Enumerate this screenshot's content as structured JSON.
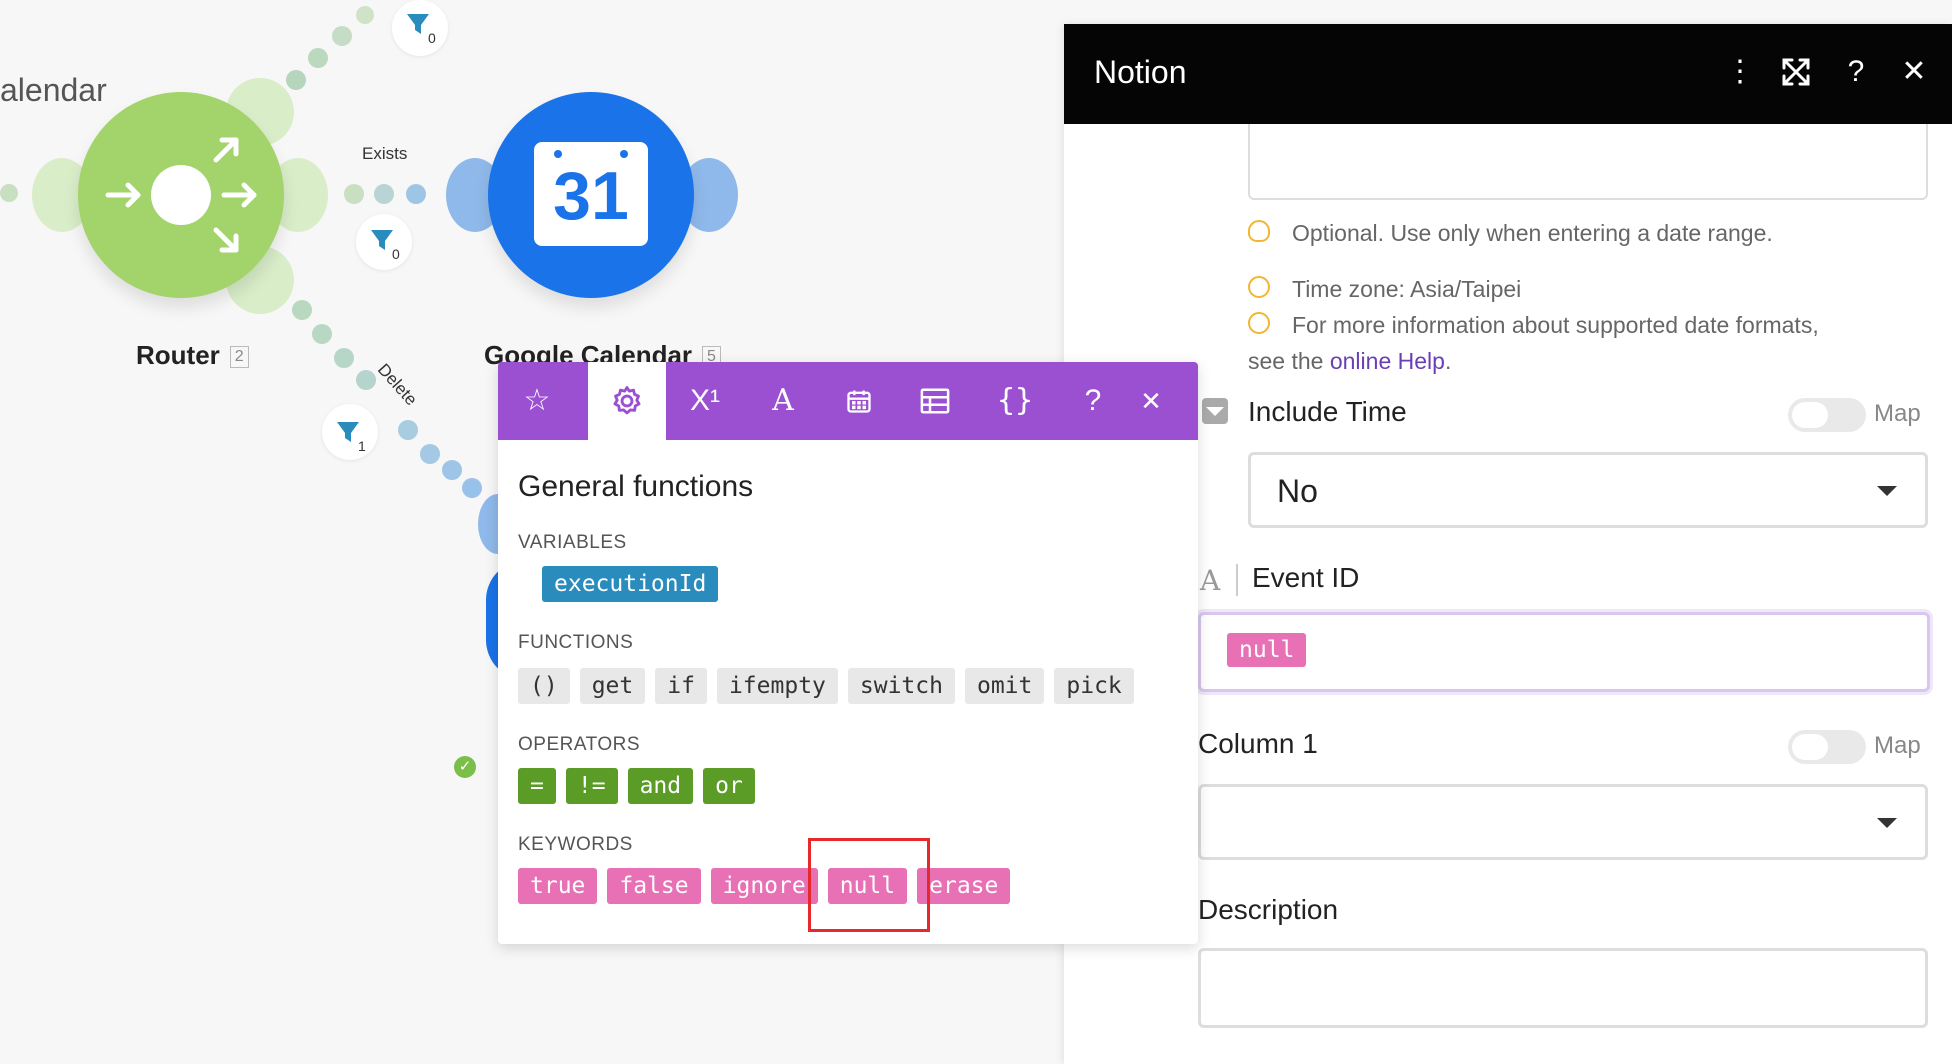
{
  "canvas": {
    "partial_title": "alendar",
    "router": {
      "label": "Router",
      "count": "2"
    },
    "gcal": {
      "label": "Google Calendar",
      "count": "5",
      "icon_text": "31"
    },
    "routes": {
      "exists_label": "Exists",
      "delete_label": "Delete"
    },
    "filters": [
      {
        "count": "0"
      },
      {
        "count": "0"
      },
      {
        "count": "1"
      }
    ]
  },
  "panel": {
    "title": "Notion",
    "hint_optional": "Optional. Use only when entering a date range.",
    "hint_timezone": "Time zone: Asia/Taipei",
    "hint_formats_prefix": "For more information about supported date formats,",
    "hint_formats_line2": "see the",
    "hint_formats_link": "online Help",
    "hint_formats_suffix": ".",
    "include_time_label": "Include Time",
    "include_time_value": "No",
    "map_label": "Map",
    "event_id_label": "Event ID",
    "event_id_value": "null",
    "column1_label": "Column 1",
    "description_label": "Description"
  },
  "popup": {
    "title": "General functions",
    "variables_title": "VARIABLES",
    "variables": [
      "executionId"
    ],
    "functions_title": "FUNCTIONS",
    "functions": [
      "()",
      "get",
      "if",
      "ifempty",
      "switch",
      "omit",
      "pick"
    ],
    "operators_title": "OPERATORS",
    "operators": [
      "=",
      "!=",
      "and",
      "or"
    ],
    "keywords_title": "KEYWORDS",
    "keywords": [
      "true",
      "false",
      "ignore",
      "null",
      "erase"
    ],
    "toolbar": {
      "superscript": "X¹",
      "text": "A",
      "braces": "{}",
      "help": "?",
      "close": "✕"
    }
  },
  "colors": {
    "router": "#a3d36b",
    "gcal": "#1a73e8",
    "popup_toolbar": "#9b4fd1",
    "panel_header": "#050505",
    "keyword_chip": "#e870b5",
    "operator_chip": "#5a9c26",
    "variable_chip": "#2a8bbd",
    "highlight_box": "#e8292b"
  }
}
